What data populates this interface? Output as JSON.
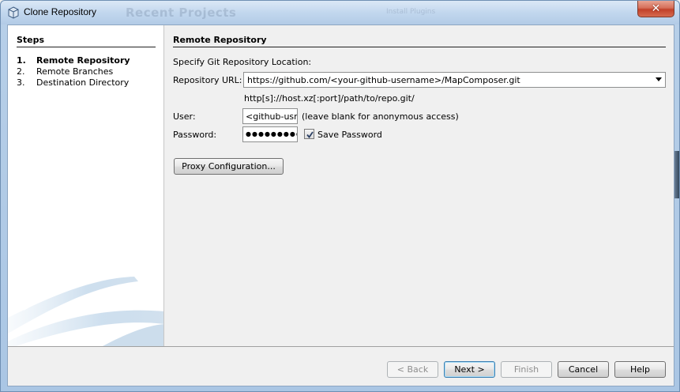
{
  "window": {
    "title": "Clone Repository",
    "background_title": "Recent Projects",
    "background_subtitle": "Install Plugins",
    "close_symbol": "✕"
  },
  "steps": {
    "heading": "Steps",
    "items": [
      {
        "num": "1.",
        "label": "Remote Repository",
        "active": true
      },
      {
        "num": "2.",
        "label": "Remote Branches",
        "active": false
      },
      {
        "num": "3.",
        "label": "Destination Directory",
        "active": false
      }
    ]
  },
  "content": {
    "heading": "Remote Repository",
    "location_label": "Specify Git Repository Location:",
    "url_label": "Repository URL:",
    "url_value": "https://github.com/<your-github-username>/MapComposer.git",
    "url_hint": "http[s]://host.xz[:port]/path/to/repo.git/",
    "user_label": "User:",
    "user_value": "<github-usr>",
    "user_hint": "(leave blank for anonymous access)",
    "password_label": "Password:",
    "password_value": "●●●●●●●●●",
    "save_password_label": "Save Password",
    "save_password_checked": true,
    "proxy_button": "Proxy Configuration..."
  },
  "footer": {
    "back": "< Back",
    "next": "Next >",
    "finish": "Finish",
    "cancel": "Cancel",
    "help": "Help"
  },
  "colors": {
    "title_bar": "#c2d7ee",
    "close_button": "#c2412a",
    "default_button_border": "#3c7fb1"
  }
}
